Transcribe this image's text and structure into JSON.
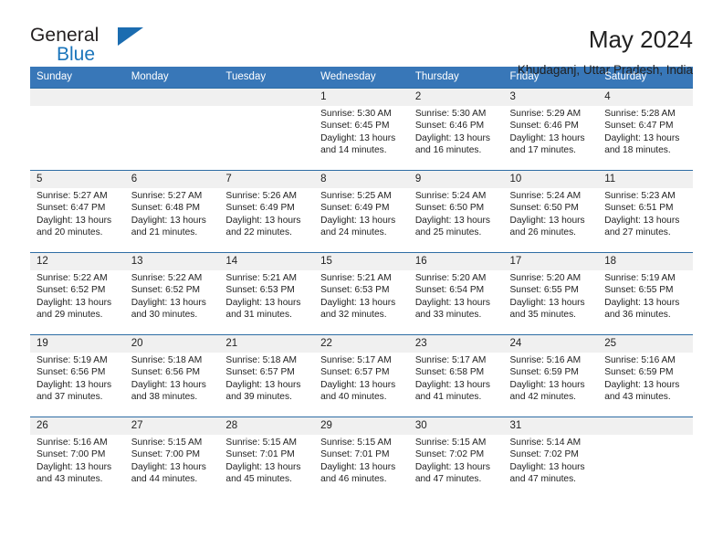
{
  "brand": {
    "name_part1": "General",
    "name_part2": "Blue",
    "triangle_color": "#1b6cb0",
    "blue_color": "#1b75bb"
  },
  "header": {
    "title": "May 2024",
    "subtitle": "Khudaganj, Uttar Pradesh, India",
    "header_bg": "#3877b8",
    "row_border": "#2e6da4",
    "daynum_bg": "#f0f0f0"
  },
  "weekdays": [
    "Sunday",
    "Monday",
    "Tuesday",
    "Wednesday",
    "Thursday",
    "Friday",
    "Saturday"
  ],
  "weeks": [
    [
      {
        "day": "",
        "empty": true,
        "sunrise": "",
        "sunset": "",
        "daylight1": "",
        "daylight2": ""
      },
      {
        "day": "",
        "empty": true,
        "sunrise": "",
        "sunset": "",
        "daylight1": "",
        "daylight2": ""
      },
      {
        "day": "",
        "empty": true,
        "sunrise": "",
        "sunset": "",
        "daylight1": "",
        "daylight2": ""
      },
      {
        "day": "1",
        "empty": false,
        "sunrise": "Sunrise: 5:30 AM",
        "sunset": "Sunset: 6:45 PM",
        "daylight1": "Daylight: 13 hours",
        "daylight2": "and 14 minutes."
      },
      {
        "day": "2",
        "empty": false,
        "sunrise": "Sunrise: 5:30 AM",
        "sunset": "Sunset: 6:46 PM",
        "daylight1": "Daylight: 13 hours",
        "daylight2": "and 16 minutes."
      },
      {
        "day": "3",
        "empty": false,
        "sunrise": "Sunrise: 5:29 AM",
        "sunset": "Sunset: 6:46 PM",
        "daylight1": "Daylight: 13 hours",
        "daylight2": "and 17 minutes."
      },
      {
        "day": "4",
        "empty": false,
        "sunrise": "Sunrise: 5:28 AM",
        "sunset": "Sunset: 6:47 PM",
        "daylight1": "Daylight: 13 hours",
        "daylight2": "and 18 minutes."
      }
    ],
    [
      {
        "day": "5",
        "empty": false,
        "sunrise": "Sunrise: 5:27 AM",
        "sunset": "Sunset: 6:47 PM",
        "daylight1": "Daylight: 13 hours",
        "daylight2": "and 20 minutes."
      },
      {
        "day": "6",
        "empty": false,
        "sunrise": "Sunrise: 5:27 AM",
        "sunset": "Sunset: 6:48 PM",
        "daylight1": "Daylight: 13 hours",
        "daylight2": "and 21 minutes."
      },
      {
        "day": "7",
        "empty": false,
        "sunrise": "Sunrise: 5:26 AM",
        "sunset": "Sunset: 6:49 PM",
        "daylight1": "Daylight: 13 hours",
        "daylight2": "and 22 minutes."
      },
      {
        "day": "8",
        "empty": false,
        "sunrise": "Sunrise: 5:25 AM",
        "sunset": "Sunset: 6:49 PM",
        "daylight1": "Daylight: 13 hours",
        "daylight2": "and 24 minutes."
      },
      {
        "day": "9",
        "empty": false,
        "sunrise": "Sunrise: 5:24 AM",
        "sunset": "Sunset: 6:50 PM",
        "daylight1": "Daylight: 13 hours",
        "daylight2": "and 25 minutes."
      },
      {
        "day": "10",
        "empty": false,
        "sunrise": "Sunrise: 5:24 AM",
        "sunset": "Sunset: 6:50 PM",
        "daylight1": "Daylight: 13 hours",
        "daylight2": "and 26 minutes."
      },
      {
        "day": "11",
        "empty": false,
        "sunrise": "Sunrise: 5:23 AM",
        "sunset": "Sunset: 6:51 PM",
        "daylight1": "Daylight: 13 hours",
        "daylight2": "and 27 minutes."
      }
    ],
    [
      {
        "day": "12",
        "empty": false,
        "sunrise": "Sunrise: 5:22 AM",
        "sunset": "Sunset: 6:52 PM",
        "daylight1": "Daylight: 13 hours",
        "daylight2": "and 29 minutes."
      },
      {
        "day": "13",
        "empty": false,
        "sunrise": "Sunrise: 5:22 AM",
        "sunset": "Sunset: 6:52 PM",
        "daylight1": "Daylight: 13 hours",
        "daylight2": "and 30 minutes."
      },
      {
        "day": "14",
        "empty": false,
        "sunrise": "Sunrise: 5:21 AM",
        "sunset": "Sunset: 6:53 PM",
        "daylight1": "Daylight: 13 hours",
        "daylight2": "and 31 minutes."
      },
      {
        "day": "15",
        "empty": false,
        "sunrise": "Sunrise: 5:21 AM",
        "sunset": "Sunset: 6:53 PM",
        "daylight1": "Daylight: 13 hours",
        "daylight2": "and 32 minutes."
      },
      {
        "day": "16",
        "empty": false,
        "sunrise": "Sunrise: 5:20 AM",
        "sunset": "Sunset: 6:54 PM",
        "daylight1": "Daylight: 13 hours",
        "daylight2": "and 33 minutes."
      },
      {
        "day": "17",
        "empty": false,
        "sunrise": "Sunrise: 5:20 AM",
        "sunset": "Sunset: 6:55 PM",
        "daylight1": "Daylight: 13 hours",
        "daylight2": "and 35 minutes."
      },
      {
        "day": "18",
        "empty": false,
        "sunrise": "Sunrise: 5:19 AM",
        "sunset": "Sunset: 6:55 PM",
        "daylight1": "Daylight: 13 hours",
        "daylight2": "and 36 minutes."
      }
    ],
    [
      {
        "day": "19",
        "empty": false,
        "sunrise": "Sunrise: 5:19 AM",
        "sunset": "Sunset: 6:56 PM",
        "daylight1": "Daylight: 13 hours",
        "daylight2": "and 37 minutes."
      },
      {
        "day": "20",
        "empty": false,
        "sunrise": "Sunrise: 5:18 AM",
        "sunset": "Sunset: 6:56 PM",
        "daylight1": "Daylight: 13 hours",
        "daylight2": "and 38 minutes."
      },
      {
        "day": "21",
        "empty": false,
        "sunrise": "Sunrise: 5:18 AM",
        "sunset": "Sunset: 6:57 PM",
        "daylight1": "Daylight: 13 hours",
        "daylight2": "and 39 minutes."
      },
      {
        "day": "22",
        "empty": false,
        "sunrise": "Sunrise: 5:17 AM",
        "sunset": "Sunset: 6:57 PM",
        "daylight1": "Daylight: 13 hours",
        "daylight2": "and 40 minutes."
      },
      {
        "day": "23",
        "empty": false,
        "sunrise": "Sunrise: 5:17 AM",
        "sunset": "Sunset: 6:58 PM",
        "daylight1": "Daylight: 13 hours",
        "daylight2": "and 41 minutes."
      },
      {
        "day": "24",
        "empty": false,
        "sunrise": "Sunrise: 5:16 AM",
        "sunset": "Sunset: 6:59 PM",
        "daylight1": "Daylight: 13 hours",
        "daylight2": "and 42 minutes."
      },
      {
        "day": "25",
        "empty": false,
        "sunrise": "Sunrise: 5:16 AM",
        "sunset": "Sunset: 6:59 PM",
        "daylight1": "Daylight: 13 hours",
        "daylight2": "and 43 minutes."
      }
    ],
    [
      {
        "day": "26",
        "empty": false,
        "sunrise": "Sunrise: 5:16 AM",
        "sunset": "Sunset: 7:00 PM",
        "daylight1": "Daylight: 13 hours",
        "daylight2": "and 43 minutes."
      },
      {
        "day": "27",
        "empty": false,
        "sunrise": "Sunrise: 5:15 AM",
        "sunset": "Sunset: 7:00 PM",
        "daylight1": "Daylight: 13 hours",
        "daylight2": "and 44 minutes."
      },
      {
        "day": "28",
        "empty": false,
        "sunrise": "Sunrise: 5:15 AM",
        "sunset": "Sunset: 7:01 PM",
        "daylight1": "Daylight: 13 hours",
        "daylight2": "and 45 minutes."
      },
      {
        "day": "29",
        "empty": false,
        "sunrise": "Sunrise: 5:15 AM",
        "sunset": "Sunset: 7:01 PM",
        "daylight1": "Daylight: 13 hours",
        "daylight2": "and 46 minutes."
      },
      {
        "day": "30",
        "empty": false,
        "sunrise": "Sunrise: 5:15 AM",
        "sunset": "Sunset: 7:02 PM",
        "daylight1": "Daylight: 13 hours",
        "daylight2": "and 47 minutes."
      },
      {
        "day": "31",
        "empty": false,
        "sunrise": "Sunrise: 5:14 AM",
        "sunset": "Sunset: 7:02 PM",
        "daylight1": "Daylight: 13 hours",
        "daylight2": "and 47 minutes."
      },
      {
        "day": "",
        "empty": true,
        "sunrise": "",
        "sunset": "",
        "daylight1": "",
        "daylight2": ""
      }
    ]
  ]
}
